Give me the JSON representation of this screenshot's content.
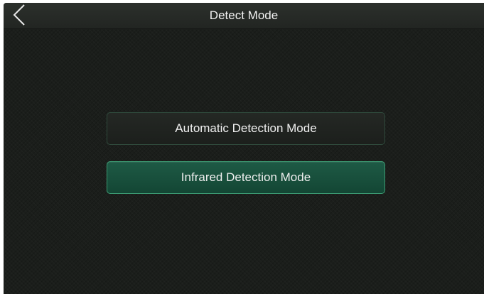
{
  "header": {
    "title": "Detect Mode",
    "back_icon": "chevron-left-icon"
  },
  "modes": [
    {
      "label": "Automatic Detection Mode",
      "selected": false
    },
    {
      "label": "Infrared Detection Mode",
      "selected": true
    }
  ],
  "colors": {
    "background": "#1b1e1b",
    "selected_button": "#1a5240",
    "selected_border": "#3c9a72",
    "text": "#f0f0f0"
  }
}
